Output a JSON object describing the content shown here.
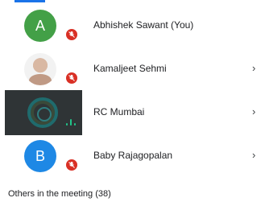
{
  "participants": [
    {
      "avatar_letter": "A",
      "name": "Abhishek Sawant (You)",
      "avatar_color": "#43a047",
      "status": "muted"
    },
    {
      "name": "Kamaljeet Sehmi",
      "status": "muted"
    },
    {
      "name": "RC Mumbai",
      "status": "speaking"
    },
    {
      "avatar_letter": "B",
      "name": "Baby Rajagopalan",
      "avatar_color": "#1e88e5",
      "status": "muted"
    }
  ],
  "others": {
    "label": "Others in the meeting (38)"
  },
  "colors": {
    "accent": "#1a73e8",
    "mute_badge": "#d93025",
    "speaking": "#21c58a"
  },
  "icons": {
    "mute": "mic-off-icon",
    "chevron": "chevron-right-icon",
    "speaking": "audio-level-icon"
  }
}
